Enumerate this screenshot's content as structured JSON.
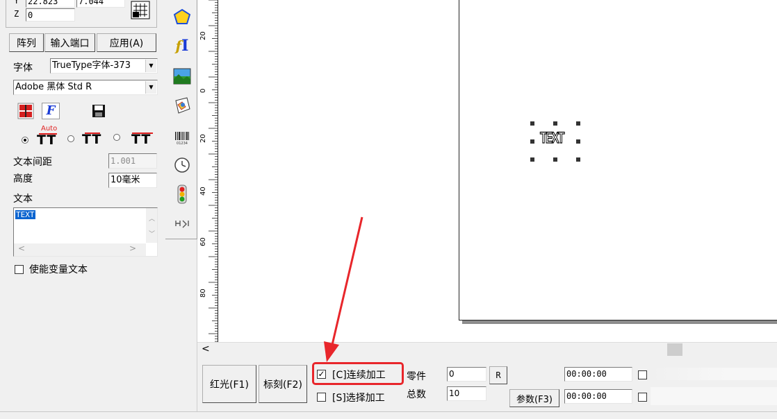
{
  "coords": {
    "y_label": "Y",
    "y_value": "22.823",
    "x_extra": "7.044",
    "z_label": "Z",
    "z_value": "0"
  },
  "buttons": {
    "array": "阵列",
    "input_port": "输入端口",
    "apply": "应用(A)"
  },
  "font": {
    "label": "字体",
    "type_value": "TrueType字体-373",
    "name_value": "Adobe 黑体 Std R"
  },
  "tt_auto_label": "Auto",
  "tt_glyph": "TT",
  "spacing": {
    "label": "文本间距",
    "value": "1.001"
  },
  "height": {
    "label": "高度",
    "value": "10毫米"
  },
  "text": {
    "label": "文本",
    "value": "TEXT"
  },
  "variable_text": {
    "label": "使能变量文本",
    "checked": false
  },
  "ruler": {
    "ticks": [
      "20",
      "0",
      "20",
      "40",
      "60",
      "80"
    ]
  },
  "canvas": {
    "object_text": "TEXT"
  },
  "bottom": {
    "red_light": "红光(F1)",
    "mark": "标刻(F2)",
    "continuous": "[C]连续加工",
    "continuous_checked": true,
    "select": "[S]选择加工",
    "select_checked": false,
    "parts_label": "零件",
    "parts_value": "0",
    "total_label": "总数",
    "total_value": "10",
    "reset_btn": "R",
    "params_btn": "参数(F3)",
    "time1": "00:00:00",
    "time2": "00:00:00"
  },
  "colors": {
    "highlight": "#e8262b",
    "selection": "#0a64d0"
  }
}
